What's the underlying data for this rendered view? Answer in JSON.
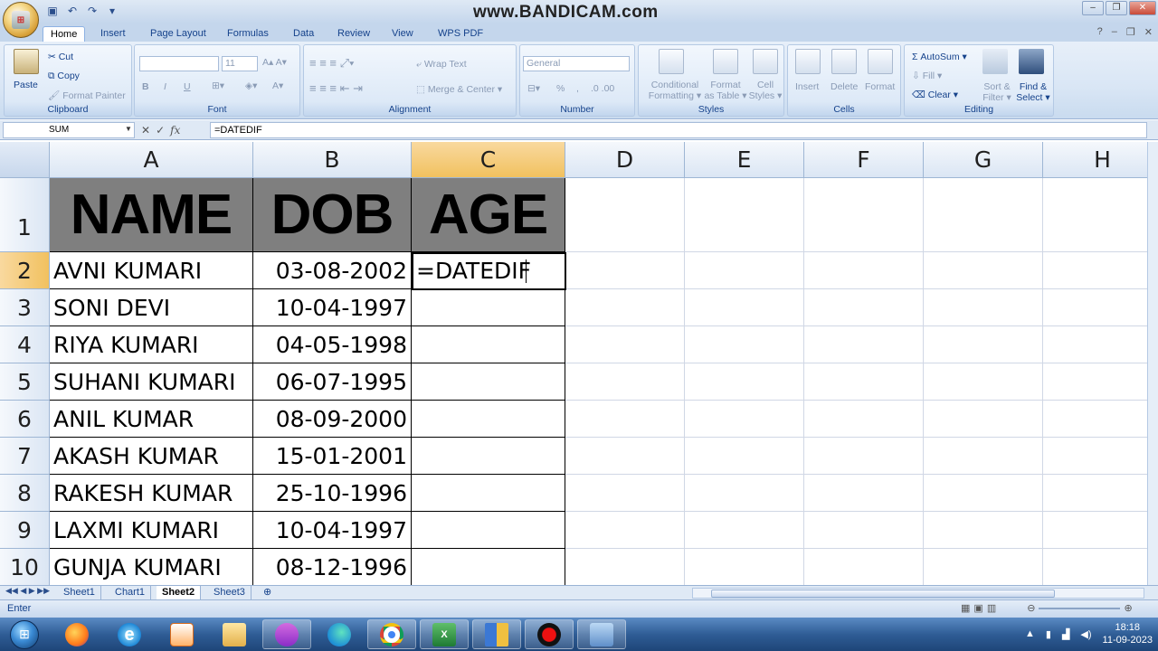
{
  "window": {
    "watermark": "www.BANDICAM.com",
    "qat_icons": [
      "save-icon",
      "undo-icon",
      "redo-icon",
      "customize-icon"
    ]
  },
  "tabs": [
    {
      "label": "Home",
      "active": true
    },
    {
      "label": "Insert"
    },
    {
      "label": "Page Layout"
    },
    {
      "label": "Formulas"
    },
    {
      "label": "Data"
    },
    {
      "label": "Review"
    },
    {
      "label": "View"
    },
    {
      "label": "WPS PDF"
    }
  ],
  "ribbon": {
    "clipboard": {
      "label": "Clipboard",
      "paste": "Paste",
      "cut": "Cut",
      "copy": "Copy",
      "format_painter": "Format Painter"
    },
    "font": {
      "label": "Font",
      "font_name": "",
      "font_size": "11",
      "bold": "B",
      "italic": "I",
      "underline": "U"
    },
    "alignment": {
      "label": "Alignment",
      "wrap_text": "Wrap Text",
      "merge_center": "Merge & Center"
    },
    "number": {
      "label": "Number",
      "format": "General",
      "percent": "%",
      "comma": ","
    },
    "styles": {
      "label": "Styles",
      "conditional": "Conditional",
      "conditional2": "Formatting",
      "format_table": "Format",
      "format_table2": "as Table",
      "cell_styles": "Cell",
      "cell_styles2": "Styles"
    },
    "cells": {
      "label": "Cells",
      "insert": "Insert",
      "delete": "Delete",
      "format": "Format"
    },
    "editing": {
      "label": "Editing",
      "autosum": "AutoSum",
      "fill": "Fill",
      "clear": "Clear",
      "sort": "Sort &",
      "sort2": "Filter",
      "find": "Find &",
      "find2": "Select"
    }
  },
  "formula_bar": {
    "name_box": "SUM",
    "cancel": "✕",
    "enter": "✓",
    "fx": "fx",
    "formula": "=DATEDIF"
  },
  "columns": [
    "A",
    "B",
    "C",
    "D",
    "E",
    "F",
    "G",
    "H"
  ],
  "rows": [
    "1",
    "2",
    "3",
    "4",
    "5",
    "6",
    "7",
    "8",
    "9",
    "10"
  ],
  "header_row": {
    "name": "NAME",
    "dob": "DOB",
    "age": "AGE"
  },
  "records": [
    {
      "name": "AVNI KUMARI",
      "dob": "03-08-2002",
      "age": "=DATEDIF"
    },
    {
      "name": "SONI DEVI",
      "dob": "10-04-1997",
      "age": ""
    },
    {
      "name": "RIYA KUMARI",
      "dob": "04-05-1998",
      "age": ""
    },
    {
      "name": "SUHANI KUMARI",
      "dob": "06-07-1995",
      "age": ""
    },
    {
      "name": "ANIL KUMAR",
      "dob": "08-09-2000",
      "age": ""
    },
    {
      "name": "AKASH KUMAR",
      "dob": "15-01-2001",
      "age": ""
    },
    {
      "name": "RAKESH KUMAR",
      "dob": "25-10-1996",
      "age": ""
    },
    {
      "name": "LAXMI KUMARI",
      "dob": "10-04-1997",
      "age": ""
    },
    {
      "name": "GUNJA KUMARI",
      "dob": "08-12-1996",
      "age": ""
    }
  ],
  "sheets": [
    {
      "label": "Sheet1"
    },
    {
      "label": "Chart1"
    },
    {
      "label": "Sheet2",
      "active": true
    },
    {
      "label": "Sheet3"
    }
  ],
  "status": {
    "mode": "Enter"
  },
  "taskbar": {
    "time": "18:18",
    "date": "11-09-2023",
    "items": [
      "firefox-icon",
      "ie-icon",
      "media-player-icon",
      "file-explorer-icon",
      "video-app-icon",
      "edge-icon",
      "chrome-icon",
      "excel-icon",
      "window-app-icon",
      "record-icon",
      "control-panel-icon"
    ]
  },
  "colors": {
    "header_fill": "#7f7f7f",
    "selected_header": "#f1c15f",
    "ribbon_text": "#15428b"
  }
}
